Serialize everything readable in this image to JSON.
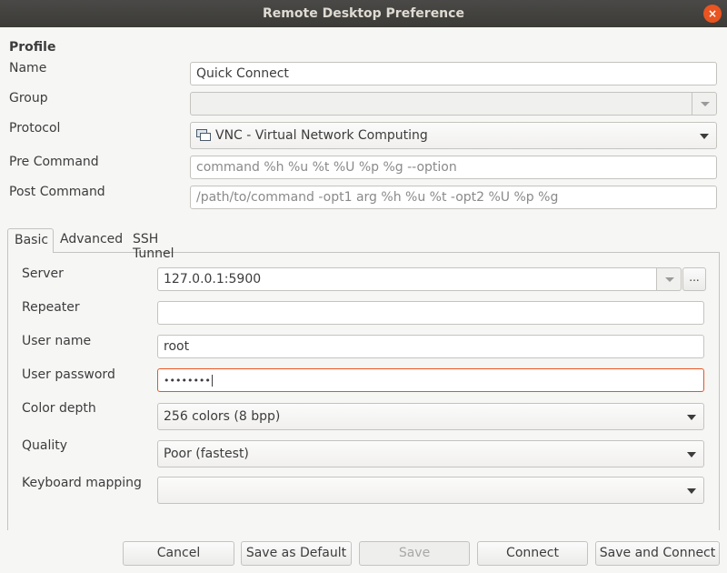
{
  "window": {
    "title": "Remote Desktop Preference",
    "close_icon": "×"
  },
  "profile": {
    "section_label": "Profile",
    "name_label": "Name",
    "name_value": "Quick Connect",
    "group_label": "Group",
    "group_value": "",
    "protocol_label": "Protocol",
    "protocol_value": "VNC - Virtual Network Computing",
    "pre_command_label": "Pre Command",
    "pre_command_placeholder": "command %h %u %t %U %p %g --option",
    "post_command_label": "Post Command",
    "post_command_placeholder": "/path/to/command -opt1 arg %h %u %t -opt2 %U %p %g"
  },
  "tabs": [
    "Basic",
    "Advanced",
    "SSH Tunnel"
  ],
  "basic": {
    "server_label": "Server",
    "server_value": "127.0.0.1:5900",
    "server_browse": "...",
    "repeater_label": "Repeater",
    "repeater_value": "",
    "username_label": "User name",
    "username_value": "root",
    "password_label": "User password",
    "password_value": "••••••••",
    "color_depth_label": "Color depth",
    "color_depth_value": "256 colors (8 bpp)",
    "quality_label": "Quality",
    "quality_value": "Poor (fastest)",
    "keyboard_label": "Keyboard mapping",
    "keyboard_value": ""
  },
  "buttons": {
    "cancel": "Cancel",
    "save_default": "Save as Default",
    "save": "Save",
    "connect": "Connect",
    "save_connect": "Save and Connect"
  },
  "colors": {
    "accent": "#e95420",
    "titlebar": "#3c3b37"
  }
}
